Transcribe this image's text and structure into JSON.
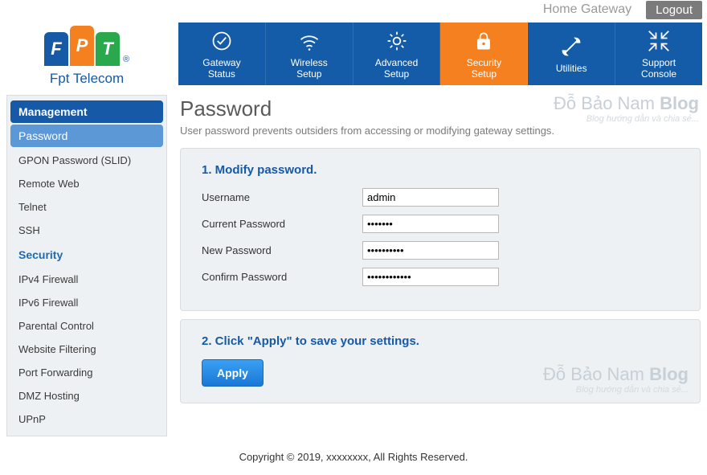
{
  "header": {
    "home_label": "Home Gateway",
    "logout_label": "Logout"
  },
  "brand": {
    "letters": [
      "F",
      "P",
      "T"
    ],
    "reg": "®",
    "name": "Fpt Telecom"
  },
  "topnav": [
    {
      "id": "gateway-status",
      "line1": "Gateway",
      "line2": "Status",
      "icon": "check-circle"
    },
    {
      "id": "wireless-setup",
      "line1": "Wireless",
      "line2": "Setup",
      "icon": "wifi"
    },
    {
      "id": "advanced-setup",
      "line1": "Advanced",
      "line2": "Setup",
      "icon": "gear"
    },
    {
      "id": "security-setup",
      "line1": "Security",
      "line2": "Setup",
      "icon": "lock",
      "active": true
    },
    {
      "id": "utilities",
      "line1": "Utilities",
      "line2": "",
      "icon": "tools"
    },
    {
      "id": "support-console",
      "line1": "Support",
      "line2": "Console",
      "icon": "compress"
    }
  ],
  "sidebar": {
    "groups": [
      {
        "title": "Management",
        "highlighted": true,
        "items": [
          {
            "label": "Password",
            "selected": true
          },
          {
            "label": "GPON Password (SLID)"
          },
          {
            "label": "Remote Web"
          },
          {
            "label": "Telnet"
          },
          {
            "label": "SSH"
          }
        ]
      },
      {
        "title": "Security",
        "highlighted": false,
        "items": [
          {
            "label": "IPv4 Firewall"
          },
          {
            "label": "IPv6 Firewall"
          },
          {
            "label": "Parental Control"
          },
          {
            "label": "Website Filtering"
          },
          {
            "label": "Port Forwarding"
          },
          {
            "label": "DMZ Hosting"
          },
          {
            "label": "UPnP"
          }
        ]
      }
    ]
  },
  "page": {
    "title": "Password",
    "description": "User password prevents outsiders from accessing or modifying gateway settings.",
    "section1": {
      "heading": "1. Modify password.",
      "fields": {
        "username_label": "Username",
        "username_value": "admin",
        "current_label": "Current Password",
        "current_value": "•••••••",
        "new_label": "New Password",
        "new_value": "••••••••••",
        "confirm_label": "Confirm Password",
        "confirm_value": "••••••••••••"
      }
    },
    "section2": {
      "heading": "2. Click \"Apply\" to save your settings.",
      "apply_label": "Apply"
    }
  },
  "watermark": {
    "main": "Đỗ Bảo Nam ",
    "bold": "Blog",
    "tagline": "Blog hướng dẫn và chia sẻ..."
  },
  "footer": "Copyright © 2019, xxxxxxxx, All Rights Reserved."
}
